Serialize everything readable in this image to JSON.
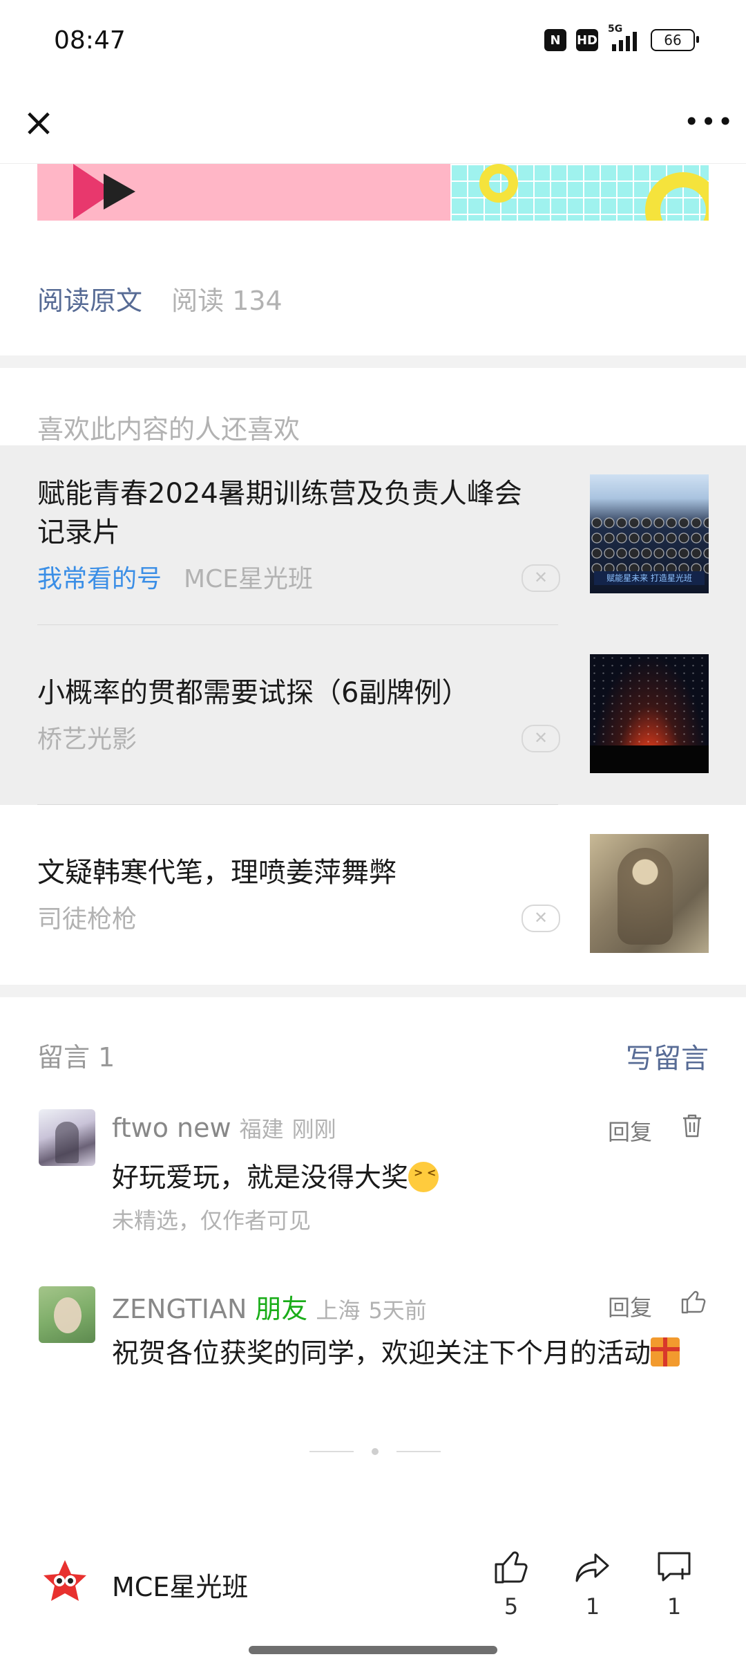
{
  "status_bar": {
    "time": "08:47",
    "network": "5G",
    "hd_label": "HD",
    "battery": "66"
  },
  "nav": {
    "close_icon": "close-icon",
    "more_icon": "more-dots-icon"
  },
  "article_footer": {
    "read_original": "阅读原文",
    "read_count": "阅读 134"
  },
  "recommend": {
    "title": "喜欢此内容的人还喜欢",
    "items": [
      {
        "title": "赋能青春2024暑期训练营及负责人峰会记录片",
        "tag": "我常看的号",
        "source": "MCE星光班",
        "thumb_caption": "赋能星未来 打造星光班"
      },
      {
        "title": "小概率的贯都需要试探（6副牌例）",
        "source": "桥艺光影"
      },
      {
        "title": "文疑韩寒代笔，理喷姜萍舞弊",
        "source": "司徒枪枪"
      }
    ]
  },
  "comments": {
    "header": "留言 1",
    "write": "写留言",
    "list": [
      {
        "name": "ftwo new",
        "location": "福建",
        "time": "刚刚",
        "text": "好玩爱玩，就是没得大奖",
        "note": "未精选，仅作者可见",
        "reply": "回复"
      },
      {
        "name": "ZENGTIAN",
        "badge": "朋友",
        "location": "上海",
        "time": "5天前",
        "text": "祝贺各位获奖的同学，欢迎关注下个月的活动",
        "reply": "回复"
      }
    ]
  },
  "bottom_bar": {
    "account": "MCE星光班",
    "like_count": "5",
    "share_count": "1",
    "comment_count": "1"
  }
}
